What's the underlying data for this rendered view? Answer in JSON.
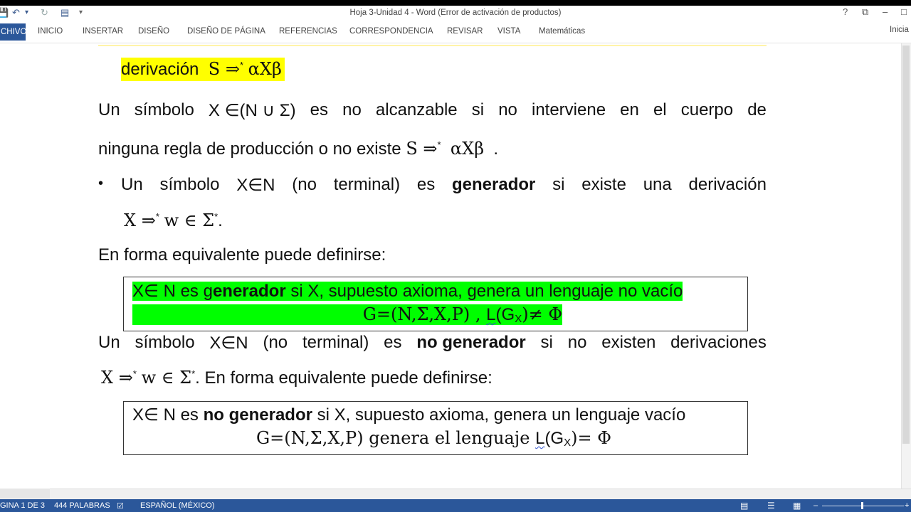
{
  "window": {
    "title": "Hoja 3-Unidad 4 - Word (Error de activación de productos)",
    "controls": {
      "help": "?",
      "restore": "⧉",
      "minimize": "–",
      "maximize": "□",
      "close": "✕"
    }
  },
  "quick_access": {
    "save": "💾",
    "undo": "↶",
    "undo_dropdown": "▾",
    "redo": "↻",
    "layout": "▤",
    "customize": "▾"
  },
  "ribbon": {
    "file_tab": "CHIVO",
    "tabs": [
      "INICIO",
      "INSERTAR",
      "DISEÑO",
      "DISEÑO DE PÁGINA",
      "REFERENCIAS",
      "CORRESPONDENCIA",
      "REVISAR",
      "VISTA",
      "Matemáticas"
    ],
    "sign_in": "Inicia"
  },
  "document": {
    "line1": {
      "text": "derivación",
      "math": "S ⇒",
      "sup": "*",
      "math2": "αXβ"
    },
    "para1": {
      "line_a_words": [
        "Un",
        "símbolo",
        "X ∈(N ∪ Σ)",
        "es",
        "no",
        "alcanzable",
        "si",
        "no",
        "interviene",
        "en",
        "el",
        "cuerpo",
        "de"
      ],
      "line_b": {
        "text": "ninguna regla de producción o no existe",
        "math": "S ⇒",
        "sup": "*",
        "math2": "αXβ",
        "end": "."
      }
    },
    "bullet1": {
      "line_a_words": [
        "Un",
        "símbolo",
        "X∈N",
        "(no",
        "terminal)",
        "es",
        "generador",
        "si",
        "existe",
        "una",
        "derivación"
      ],
      "bold_word": "generador",
      "line_b": {
        "math": "X ⇒",
        "sup": "*",
        "math2": "w ∈ Σ",
        "sup2": "*",
        "end": "."
      }
    },
    "para2": "En forma equivalente puede definirse:",
    "box1": {
      "line_a": {
        "pre": "X∈ N es g",
        "bold": "enerador",
        "post": " si  X, supuesto axioma, genera un lenguaje no vacío"
      },
      "line_b": {
        "pre": "G=(N,Σ,X,P) ,  ",
        "lang": "L",
        "post_a": "(G",
        "sub": "X",
        "post_b": ")≠ Φ"
      }
    },
    "para3": {
      "line_a_words": [
        "Un",
        "símbolo",
        "X∈N",
        "(no",
        "terminal)",
        "es",
        "no generador",
        "si",
        "no",
        "existen",
        "derivaciones"
      ],
      "bold_word": "no generador",
      "line_b": {
        "math": "X ⇒",
        "sup": "*",
        "math2": "w ∈ Σ",
        "sup2": "*",
        "text": ".  En forma equivalente puede definirse:"
      }
    },
    "box2": {
      "line_a": {
        "pre": "X∈ N es ",
        "bold": "no generador",
        "post": " si  X, supuesto axioma, genera un lenguaje vacío"
      },
      "line_b": {
        "pre": "G=(N,Σ,X,P) genera el lenguaje ",
        "lang": "L",
        "post_a": "(G",
        "sub": "X",
        "post_b": ")= Φ"
      }
    }
  },
  "status_bar": {
    "page": "GINA 1 DE 3",
    "words": "444 PALABRAS",
    "proofing_icon": "☑",
    "language": "ESPAÑOL (MÉXICO)",
    "view_icons": [
      "▤",
      "☰",
      "▦"
    ],
    "zoom_minus": "–",
    "zoom_plus": "+"
  },
  "colors": {
    "brand": "#2b579a",
    "highlight_yellow": "#ffff00",
    "highlight_green": "#00ff00"
  }
}
